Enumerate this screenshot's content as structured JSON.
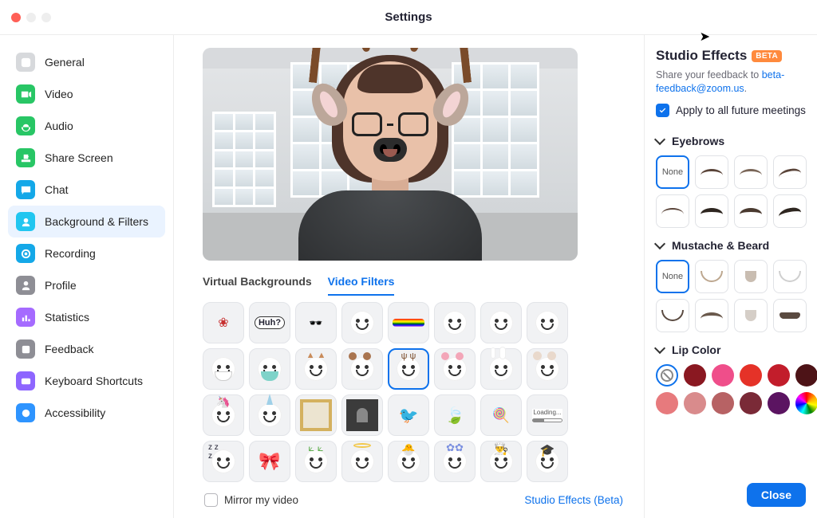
{
  "title": "Settings",
  "sidebar": {
    "items": [
      {
        "label": "General",
        "color": "#d7d9dc"
      },
      {
        "label": "Video",
        "color": "#28c665"
      },
      {
        "label": "Audio",
        "color": "#28c665"
      },
      {
        "label": "Share Screen",
        "color": "#28c665"
      },
      {
        "label": "Chat",
        "color": "#14a8e8"
      },
      {
        "label": "Background & Filters",
        "color": "#21c6f0"
      },
      {
        "label": "Recording",
        "color": "#14a8e8"
      },
      {
        "label": "Profile",
        "color": "#8e8e95"
      },
      {
        "label": "Statistics",
        "color": "#a56bff"
      },
      {
        "label": "Feedback",
        "color": "#8e8e95"
      },
      {
        "label": "Keyboard Shortcuts",
        "color": "#8e66ff"
      },
      {
        "label": "Accessibility",
        "color": "#2e94ff"
      }
    ],
    "active_index": 5
  },
  "main": {
    "tabs": [
      {
        "label": "Virtual Backgrounds"
      },
      {
        "label": "Video Filters"
      }
    ],
    "active_tab": 1,
    "selected_filter_index": 12,
    "mirror_label": "Mirror my video",
    "mirror_checked": false,
    "studio_link": "Studio Effects (Beta)"
  },
  "filters": [
    "wreath",
    "huh",
    "deal-glasses",
    "blush",
    "rainbow",
    "squint",
    "surprised",
    "curious",
    "mask",
    "surgical-mask",
    "fox",
    "bear",
    "reindeer",
    "pig",
    "bunny",
    "mouse",
    "unicorn",
    "narwhal",
    "frame-gold",
    "frame-dark",
    "bird",
    "leaf",
    "lollipops",
    "loading",
    "sleepy",
    "bow",
    "antennae",
    "halo",
    "chick",
    "flowers",
    "chef-hat",
    "grad-cap"
  ],
  "right": {
    "title": "Studio Effects",
    "beta": "BETA",
    "feedback_prefix": "Share your feedback to ",
    "feedback_link": "beta-feedback@zoom.us",
    "feedback_suffix": ".",
    "apply_label": "Apply to all future meetings",
    "apply_checked": true,
    "sections": {
      "eyebrows": {
        "label": "Eyebrows",
        "none": "None"
      },
      "beard": {
        "label": "Mustache & Beard",
        "none": "None"
      },
      "lip": {
        "label": "Lip Color"
      }
    },
    "lip_colors": [
      "none",
      "#8a1821",
      "#ef4e8a",
      "#e53228",
      "#c21d2b",
      "#4d1317",
      "#e77a7d",
      "#d98b8c",
      "#b76264",
      "#7a2a37",
      "#5b1461",
      "rainbow"
    ]
  },
  "close": "Close"
}
